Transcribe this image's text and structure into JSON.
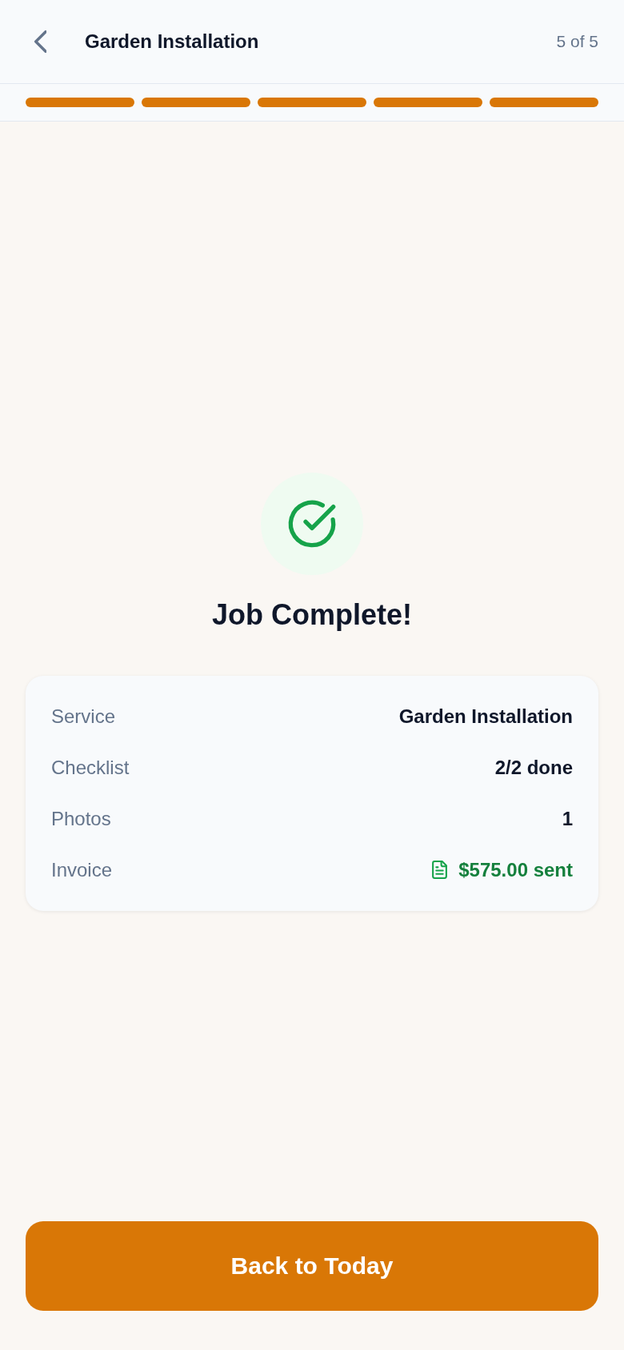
{
  "header": {
    "title": "Garden Installation",
    "step_counter": "5 of 5"
  },
  "progress": {
    "steps": [
      {
        "done": true
      },
      {
        "done": true
      },
      {
        "done": true
      },
      {
        "done": true
      },
      {
        "done": true
      }
    ]
  },
  "result": {
    "title": "Job Complete!"
  },
  "summary": {
    "rows": [
      {
        "kind": "text",
        "label": "Service",
        "value": "Garden Installation"
      },
      {
        "kind": "text",
        "label": "Checklist",
        "value": "2/2 done"
      },
      {
        "kind": "text",
        "label": "Photos",
        "value": "1"
      },
      {
        "kind": "invoice",
        "label": "Invoice",
        "value": "$575.00 sent"
      }
    ]
  },
  "primary_button": {
    "label": "Back to Today"
  }
}
